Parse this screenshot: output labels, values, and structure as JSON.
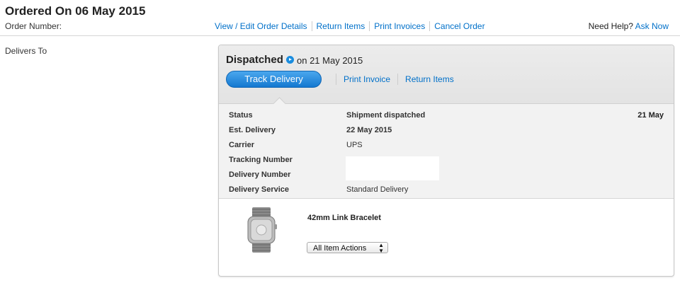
{
  "header": {
    "title": "Ordered On 06 May 2015",
    "order_number_label": "Order Number:",
    "links": [
      "View / Edit Order Details",
      "Return Items",
      "Print Invoices",
      "Cancel Order"
    ],
    "help_text": "Need Help?",
    "help_link": "Ask Now"
  },
  "delivers_to_label": "Delivers To",
  "shipment": {
    "status_title": "Dispatched",
    "status_date": "on 21 May 2015",
    "track_button": "Track Delivery",
    "links": [
      "Print Invoice",
      "Return Items"
    ],
    "date_right": "21 May",
    "rows": [
      {
        "label": "Status",
        "value": "Shipment dispatched"
      },
      {
        "label": "Est. Delivery",
        "value": "22 May 2015"
      },
      {
        "label": "Carrier",
        "value": "UPS"
      },
      {
        "label": "Tracking Number",
        "value": ""
      },
      {
        "label": "Delivery Number",
        "value": ""
      },
      {
        "label": "Delivery Service",
        "value": "Standard Delivery"
      }
    ]
  },
  "item": {
    "name": "42mm Link Bracelet",
    "actions_select": "All Item Actions"
  },
  "colors": {
    "link": "#0070c9",
    "button": "#1478d0"
  }
}
